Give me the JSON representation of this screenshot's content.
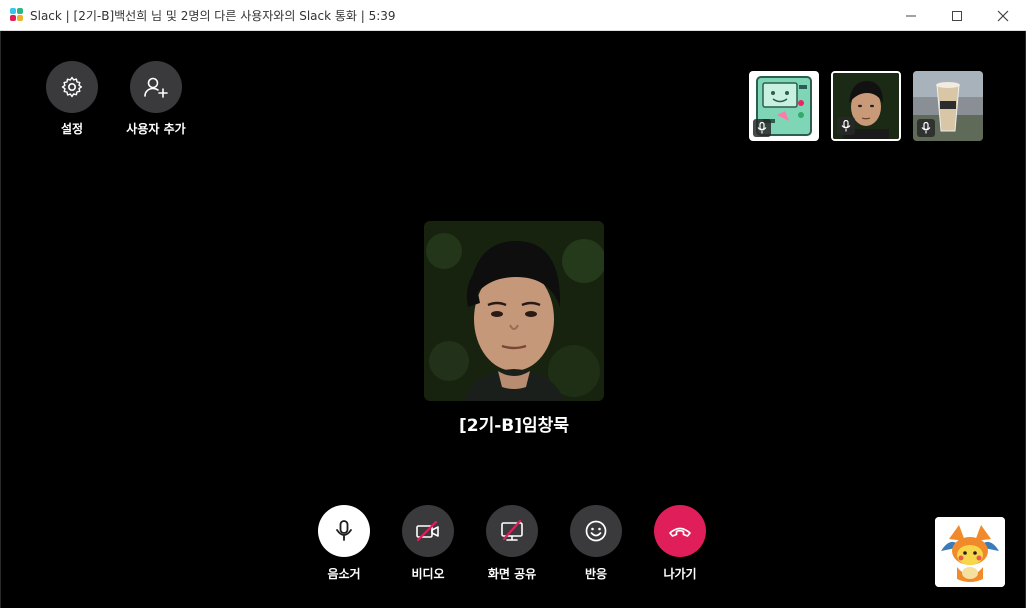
{
  "window": {
    "title": "Slack | [2기-B]백선희 님 및 2명의 다른 사용자와의 Slack 통화 | 5:39",
    "controls": [
      "minimize-icon",
      "maximize-icon",
      "close-icon"
    ]
  },
  "top_actions": [
    {
      "label": "설정",
      "icon": "gear-icon"
    },
    {
      "label": "사용자 추가",
      "icon": "add-user-icon"
    }
  ],
  "participants": [
    {
      "avatar": "robot-game-character",
      "muted_icon": "mic-icon",
      "active": false
    },
    {
      "avatar": "young-man-photo",
      "muted_icon": "mic-icon",
      "active": true
    },
    {
      "avatar": "drink-cup-photo",
      "muted_icon": "mic-icon",
      "active": false
    }
  ],
  "active_speaker": {
    "name": "[2기-B]임창묵",
    "avatar": "young-man-photo"
  },
  "controls": [
    {
      "label": "음소거",
      "icon": "mic-icon",
      "style": "white"
    },
    {
      "label": "비디오",
      "icon": "video-off-icon",
      "style": "dark"
    },
    {
      "label": "화면 공유",
      "icon": "screen-share-off-icon",
      "style": "dark"
    },
    {
      "label": "반응",
      "icon": "smile-icon",
      "style": "dark"
    },
    {
      "label": "나가기",
      "icon": "hang-up-icon",
      "style": "red"
    }
  ],
  "self_view": {
    "avatar": "pikachu-charizard-costume"
  },
  "colors": {
    "background": "#000000",
    "button_dark": "#3a3a3d",
    "button_white": "#ffffff",
    "leave_red": "#e01e5a",
    "disabled_slash": "#e01e5a"
  }
}
